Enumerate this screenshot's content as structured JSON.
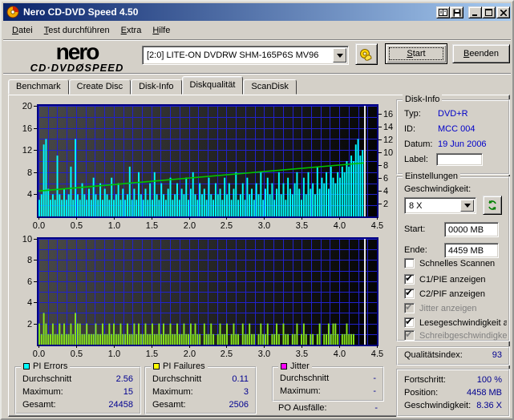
{
  "window": {
    "title": "Nero CD-DVD Speed 4.50"
  },
  "menu": {
    "items": [
      {
        "label": "Datei"
      },
      {
        "label": "Test durchführen"
      },
      {
        "label": "Extra"
      },
      {
        "label": "Hilfe"
      }
    ]
  },
  "toolbar": {
    "logo_top": "nero",
    "logo_bottom": "CD·DVDØSPEED",
    "drive_select": "[2:0]  LITE-ON DVDRW SHM-165P6S MV96",
    "start_label": "Start",
    "quit_label": "Beenden"
  },
  "tabs": {
    "items": [
      "Benchmark",
      "Create Disc",
      "Disk-Info",
      "Diskqualität",
      "ScanDisk"
    ],
    "active": "Diskqualität"
  },
  "disk_info": {
    "title": "Disk-Info",
    "rows": [
      {
        "label": "Typ:",
        "value": "DVD+R"
      },
      {
        "label": "ID:",
        "value": "MCC 004"
      },
      {
        "label": "Datum:",
        "value": "19 Jun 2006"
      },
      {
        "label": "Label:",
        "value": ""
      }
    ]
  },
  "settings": {
    "title": "Einstellungen",
    "speed_label": "Geschwindigkeit:",
    "speed_value": "8 X",
    "start_label": "Start:",
    "start_value": "0000 MB",
    "end_label": "Ende:",
    "end_value": "4459 MB",
    "checkboxes": [
      {
        "label": "Schnelles Scannen",
        "checked": false,
        "enabled": true
      },
      {
        "label": "C1/PIE anzeigen",
        "checked": true,
        "enabled": true
      },
      {
        "label": "C2/PIF anzeigen",
        "checked": true,
        "enabled": true
      },
      {
        "label": "Jitter anzeigen",
        "checked": true,
        "enabled": false
      },
      {
        "label": "Lesegeschwindigkeit a",
        "checked": true,
        "enabled": true
      },
      {
        "label": "Schreibgeschwindigke",
        "checked": true,
        "enabled": false
      }
    ]
  },
  "quality": {
    "label": "Qualitätsindex:",
    "value": "93"
  },
  "progress": {
    "rows": [
      {
        "label": "Fortschritt:",
        "value": "100 %"
      },
      {
        "label": "Position:",
        "value": "4458 MB"
      },
      {
        "label": "Geschwindigkeit:",
        "value": "8.36 X"
      }
    ]
  },
  "stats": {
    "pi_errors": {
      "title": "PI Errors",
      "color": "#00ffff",
      "rows": [
        {
          "label": "Durchschnitt",
          "value": "2.56"
        },
        {
          "label": "Maximum:",
          "value": "15"
        },
        {
          "label": "Gesamt:",
          "value": "24458"
        }
      ]
    },
    "pi_failures": {
      "title": "PI Failures",
      "color": "#ffff00",
      "rows": [
        {
          "label": "Durchschnitt",
          "value": "0.11"
        },
        {
          "label": "Maximum:",
          "value": "3"
        },
        {
          "label": "Gesamt:",
          "value": "2506"
        }
      ]
    },
    "jitter": {
      "title": "Jitter",
      "color": "#ff00ff",
      "rows": [
        {
          "label": "Durchschnitt",
          "value": "-"
        },
        {
          "label": "Maximum:",
          "value": "-"
        }
      ]
    },
    "po_failures": {
      "label": "PO Ausfälle:",
      "value": "-"
    }
  },
  "chart_data": [
    {
      "name": "pi_errors_scan",
      "type": "bar",
      "x_axis": {
        "range": [
          0,
          4.5
        ],
        "tick_step": 0.5,
        "grid_step": 0.125,
        "tick_labels": [
          "0.0",
          "0.5",
          "1.0",
          "1.5",
          "2.0",
          "2.5",
          "3.0",
          "3.5",
          "4.0",
          "4.5"
        ]
      },
      "y_left": {
        "range": [
          0,
          20
        ],
        "grid_step": 2,
        "ticks": [
          4,
          8,
          12,
          16,
          20
        ]
      },
      "y_right": {
        "range": [
          0,
          17.3
        ],
        "ticks": [
          2,
          4,
          6,
          8,
          10,
          12,
          14,
          16
        ]
      },
      "bg": {
        "from": "#4a4a4a",
        "to": "#000000"
      },
      "grid_color": "#2121cd",
      "border_color": "#000080",
      "bars": {
        "name": "PI Errors",
        "color": "#00ffff",
        "x_start": 0,
        "x_end": 4.33,
        "values": [
          3,
          4,
          13,
          14,
          5,
          3,
          4,
          3,
          11,
          4,
          3,
          5,
          3,
          4,
          9,
          3,
          14,
          4,
          3,
          6,
          4,
          3,
          5,
          3,
          7,
          4,
          3,
          6,
          3,
          5,
          4,
          3,
          7,
          3,
          4,
          6,
          3,
          5,
          3,
          4,
          9,
          3,
          5,
          3,
          8,
          4,
          3,
          5,
          3,
          6,
          3,
          8,
          4,
          3,
          6,
          4,
          3,
          5,
          7,
          3,
          4,
          6,
          3,
          5,
          4,
          7,
          3,
          5,
          8,
          4,
          3,
          6,
          4,
          5,
          3,
          7,
          4,
          3,
          6,
          4,
          5,
          3,
          7,
          4,
          6,
          3,
          5,
          8,
          3,
          4,
          6,
          3,
          7,
          4,
          5,
          3,
          6,
          4,
          8,
          3,
          5,
          7,
          4,
          6,
          3,
          5,
          8,
          4,
          6,
          3,
          7,
          5,
          4,
          6,
          8,
          5,
          3,
          7,
          4,
          8,
          5,
          6,
          4,
          9,
          5,
          7,
          6,
          8,
          5,
          9,
          7,
          6,
          8,
          7,
          9,
          8,
          10,
          9,
          11,
          10,
          13,
          14,
          11,
          12
        ]
      },
      "line": {
        "name": "Lesegeschwindigkeit",
        "color": "#00c400",
        "axis": "right",
        "points": [
          [
            0,
            3.97
          ],
          [
            4.33,
            8.36
          ]
        ]
      },
      "end_marker": {
        "x": 4.33,
        "color": "#e8e8e8"
      }
    },
    {
      "name": "pi_failures_scan",
      "type": "bar",
      "x_axis": {
        "range": [
          0,
          4.5
        ],
        "tick_step": 0.5,
        "grid_step": 0.125,
        "tick_labels": [
          "0.0",
          "0.5",
          "1.0",
          "1.5",
          "2.0",
          "2.5",
          "3.0",
          "3.5",
          "4.0",
          "4.5"
        ]
      },
      "y_left": {
        "range": [
          0,
          10
        ],
        "grid_step": 1,
        "ticks": [
          2,
          4,
          6,
          8,
          10
        ]
      },
      "bg": {
        "from": "#4a4a4a",
        "to": "#000000"
      },
      "grid_color": "#2121cd",
      "border_color": "#000080",
      "bars": {
        "name": "PI Failures",
        "color": "#86e61c",
        "x_start": 0,
        "x_end": 4.33,
        "values": [
          2,
          1,
          3,
          2,
          1,
          1,
          2,
          1,
          1,
          2,
          1,
          2,
          1,
          1,
          2,
          1,
          3,
          2,
          2,
          1,
          1,
          2,
          1,
          1,
          1,
          2,
          1,
          1,
          2,
          1,
          1,
          2,
          1,
          2,
          1,
          1,
          2,
          1,
          1,
          2,
          1,
          1,
          2,
          1,
          2,
          1,
          1,
          2,
          1,
          1,
          2,
          1,
          1,
          2,
          1,
          2,
          1,
          1,
          2,
          1,
          1,
          2,
          1,
          1,
          2,
          1,
          1,
          2,
          1,
          2,
          1,
          1,
          0,
          2,
          1,
          1,
          2,
          1,
          0,
          1,
          2,
          1,
          1,
          2,
          0,
          1,
          2,
          1,
          1,
          0,
          2,
          1,
          1,
          2,
          1,
          1,
          0,
          1,
          2,
          1,
          1,
          2,
          0,
          1,
          1,
          2,
          1,
          0,
          2,
          1,
          1,
          0,
          1,
          1,
          2,
          0,
          1,
          2,
          1,
          0,
          1,
          1,
          0,
          1,
          2,
          0,
          1,
          1,
          2,
          1,
          2,
          2,
          1,
          0,
          1,
          1,
          2,
          1,
          1,
          1,
          0,
          0,
          0,
          0
        ]
      },
      "end_marker": {
        "x": 4.33,
        "color": "#e8e8e8"
      }
    }
  ]
}
